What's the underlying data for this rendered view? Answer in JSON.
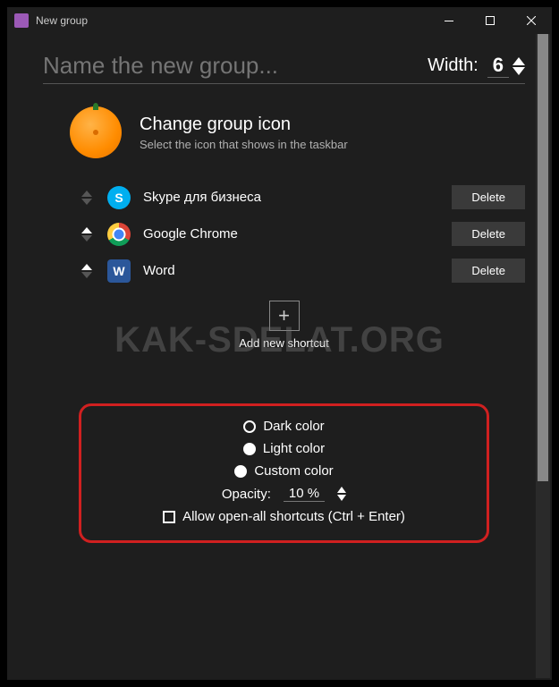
{
  "titlebar": {
    "text": "New group"
  },
  "header": {
    "name_placeholder": "Name the new group...",
    "width_label": "Width:",
    "width_value": "6"
  },
  "icon_section": {
    "title": "Change group icon",
    "subtitle": "Select the icon that shows in the taskbar"
  },
  "shortcuts": [
    {
      "name": "Skypе для бизнеса",
      "icon": "skype",
      "letter": "S",
      "delete": "Delete",
      "up_dim": true,
      "dn_dim": true
    },
    {
      "name": "Google Chrome",
      "icon": "chrome",
      "letter": "",
      "delete": "Delete",
      "up_dim": false,
      "dn_dim": true
    },
    {
      "name": "Word",
      "icon": "word",
      "letter": "W",
      "delete": "Delete",
      "up_dim": false,
      "dn_dim": true
    }
  ],
  "add": {
    "label": "Add new shortcut",
    "symbol": "+"
  },
  "settings": {
    "radios": [
      "Dark color",
      "Light color",
      "Custom color"
    ],
    "selected": 0,
    "opacity_label": "Opacity:",
    "opacity_value": "10 %",
    "allow_label": "Allow open-all shortcuts (Ctrl + Enter)"
  },
  "watermark": "KAK-SDELAT.ORG"
}
